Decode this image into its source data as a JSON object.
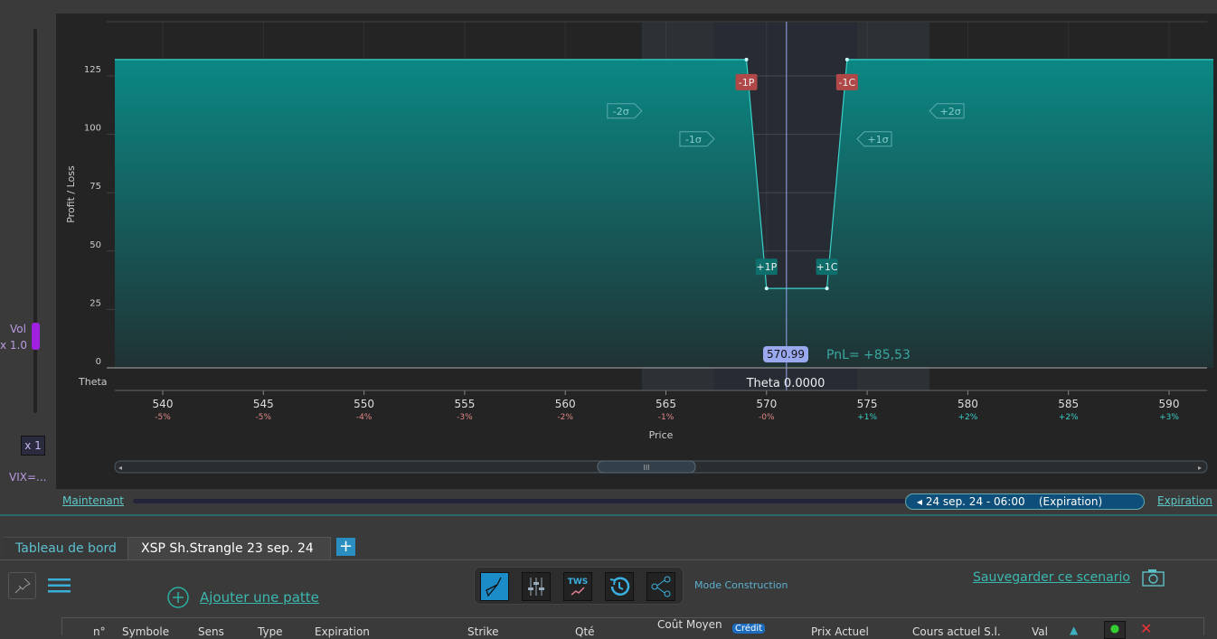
{
  "left_panel": {
    "vol_label": "Vol",
    "vol_multiplier": "x 1.0",
    "vol_level": 0.2,
    "zoom_button": "x 1",
    "vix_label": "VIX=..."
  },
  "chart_data": {
    "type": "line",
    "title": "",
    "ylabel": "Profit / Loss",
    "xlabel": "Price",
    "ylim": [
      0,
      140
    ],
    "yticks": [
      0,
      25,
      50,
      75,
      100,
      125
    ],
    "xlim": [
      537.6,
      592.2
    ],
    "xticks": [
      540,
      545,
      550,
      555,
      560,
      565,
      570,
      575,
      580,
      585,
      590
    ],
    "xtick_pct": [
      "-5%",
      "-5%",
      "-4%",
      "-3%",
      "-2%",
      "-1%",
      "-0%",
      "+1%",
      "+2%",
      "+2%",
      "+3%"
    ],
    "payoff": [
      [
        537.6,
        132
      ],
      [
        569,
        132
      ],
      [
        570,
        34
      ],
      [
        573,
        34
      ],
      [
        574,
        132
      ],
      [
        592.2,
        132
      ]
    ],
    "leg_markers": [
      {
        "label": "-1P",
        "price": 569,
        "value": 132,
        "kind": "short"
      },
      {
        "label": "-1C",
        "price": 574,
        "value": 132,
        "kind": "short"
      },
      {
        "label": "+1P",
        "price": 570,
        "value": 34,
        "kind": "long"
      },
      {
        "label": "+1C",
        "price": 573,
        "value": 34,
        "kind": "long"
      }
    ],
    "sigma_bands": [
      {
        "label": "-2σ",
        "price": 563.8,
        "level": 110
      },
      {
        "label": "-1σ",
        "price": 567.4,
        "level": 98
      },
      {
        "label": "+1σ",
        "price": 574.5,
        "level": 98
      },
      {
        "label": "+2σ",
        "price": 578.1,
        "level": 110
      }
    ],
    "current_price": 570.99,
    "current_price_label": "570.99",
    "pnl_label": "PnL= +85,53",
    "theta_row_label": "Theta",
    "theta_value": "Theta 0.0000"
  },
  "timeline": {
    "now_label": "Maintenant",
    "date_label": "24 sep. 24 - 06:00    (Expiration)",
    "expiration_link": "Expiration"
  },
  "tabs": [
    {
      "label": "Tableau de bord",
      "active": false
    },
    {
      "label": "XSP Sh.Strangle 23 sep. 24",
      "active": true
    }
  ],
  "add_tab": "+",
  "toolbar": {
    "mode_label": "Mode Construction",
    "tws_label": "TWS"
  },
  "add_leg_label": "Ajouter une patte",
  "save_scenario_label": "Sauvegarder ce scenario",
  "table": {
    "headers": [
      "n°",
      "Symbole",
      "Sens",
      "Type",
      "Expiration",
      "Strike",
      "Qté",
      "Coût Moyen",
      "Crédit",
      "Prix Actuel",
      "Cours actuel S.l.",
      "Val"
    ]
  },
  "colors": {
    "teal": "#0e8783",
    "short": "#b04848",
    "long": "#0d6e6c",
    "price_tag": "#9aa8f0"
  }
}
